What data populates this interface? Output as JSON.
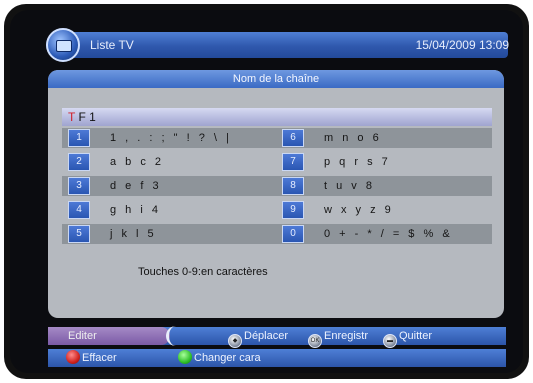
{
  "header": {
    "title": "Liste TV",
    "datetime": "15/04/2009 13:09"
  },
  "panel": {
    "title": "Nom de la chaîne",
    "input": {
      "cursor_char": "T",
      "rest": " F 1"
    },
    "keys": [
      {
        "left_key": "1",
        "left_chars": "1 , . : ; \" ! ? \\ |",
        "right_key": "6",
        "right_chars": "m n o 6"
      },
      {
        "left_key": "2",
        "left_chars": "a b c 2",
        "right_key": "7",
        "right_chars": "p q r s 7"
      },
      {
        "left_key": "3",
        "left_chars": "d e f 3",
        "right_key": "8",
        "right_chars": "t u v 8"
      },
      {
        "left_key": "4",
        "left_chars": "g h i 4",
        "right_key": "9",
        "right_chars": "w x y z 9"
      },
      {
        "left_key": "5",
        "left_chars": "j k l 5",
        "right_key": "0",
        "right_chars": "0 + - * / = $ % &"
      }
    ],
    "hint": "Touches 0-9:en caractères"
  },
  "footer": {
    "mode_tab": "Editer",
    "move_label": "Déplacer",
    "ok_icon_text": "OK",
    "save_label": "Enregistr",
    "exit_label": "Quitter",
    "erase_label": "Effacer",
    "change_label": "Changer cara",
    "colors": {
      "red": "#d0231f",
      "green": "#2fbf2a"
    }
  }
}
